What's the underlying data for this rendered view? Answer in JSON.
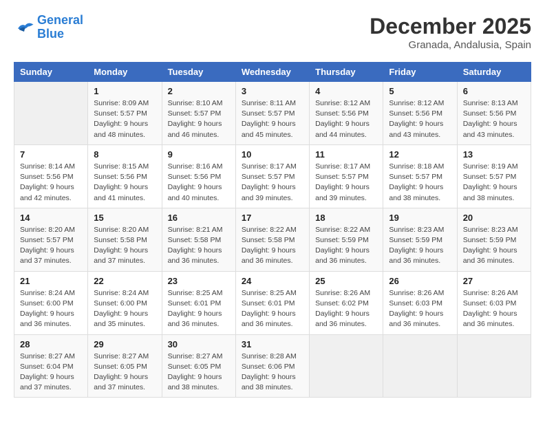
{
  "logo": {
    "line1": "General",
    "line2": "Blue"
  },
  "title": {
    "month": "December 2025",
    "location": "Granada, Andalusia, Spain"
  },
  "headers": [
    "Sunday",
    "Monday",
    "Tuesday",
    "Wednesday",
    "Thursday",
    "Friday",
    "Saturday"
  ],
  "weeks": [
    [
      {
        "day": "",
        "detail": ""
      },
      {
        "day": "1",
        "detail": "Sunrise: 8:09 AM\nSunset: 5:57 PM\nDaylight: 9 hours\nand 48 minutes."
      },
      {
        "day": "2",
        "detail": "Sunrise: 8:10 AM\nSunset: 5:57 PM\nDaylight: 9 hours\nand 46 minutes."
      },
      {
        "day": "3",
        "detail": "Sunrise: 8:11 AM\nSunset: 5:57 PM\nDaylight: 9 hours\nand 45 minutes."
      },
      {
        "day": "4",
        "detail": "Sunrise: 8:12 AM\nSunset: 5:56 PM\nDaylight: 9 hours\nand 44 minutes."
      },
      {
        "day": "5",
        "detail": "Sunrise: 8:12 AM\nSunset: 5:56 PM\nDaylight: 9 hours\nand 43 minutes."
      },
      {
        "day": "6",
        "detail": "Sunrise: 8:13 AM\nSunset: 5:56 PM\nDaylight: 9 hours\nand 43 minutes."
      }
    ],
    [
      {
        "day": "7",
        "detail": "Sunrise: 8:14 AM\nSunset: 5:56 PM\nDaylight: 9 hours\nand 42 minutes."
      },
      {
        "day": "8",
        "detail": "Sunrise: 8:15 AM\nSunset: 5:56 PM\nDaylight: 9 hours\nand 41 minutes."
      },
      {
        "day": "9",
        "detail": "Sunrise: 8:16 AM\nSunset: 5:56 PM\nDaylight: 9 hours\nand 40 minutes."
      },
      {
        "day": "10",
        "detail": "Sunrise: 8:17 AM\nSunset: 5:57 PM\nDaylight: 9 hours\nand 39 minutes."
      },
      {
        "day": "11",
        "detail": "Sunrise: 8:17 AM\nSunset: 5:57 PM\nDaylight: 9 hours\nand 39 minutes."
      },
      {
        "day": "12",
        "detail": "Sunrise: 8:18 AM\nSunset: 5:57 PM\nDaylight: 9 hours\nand 38 minutes."
      },
      {
        "day": "13",
        "detail": "Sunrise: 8:19 AM\nSunset: 5:57 PM\nDaylight: 9 hours\nand 38 minutes."
      }
    ],
    [
      {
        "day": "14",
        "detail": "Sunrise: 8:20 AM\nSunset: 5:57 PM\nDaylight: 9 hours\nand 37 minutes."
      },
      {
        "day": "15",
        "detail": "Sunrise: 8:20 AM\nSunset: 5:58 PM\nDaylight: 9 hours\nand 37 minutes."
      },
      {
        "day": "16",
        "detail": "Sunrise: 8:21 AM\nSunset: 5:58 PM\nDaylight: 9 hours\nand 36 minutes."
      },
      {
        "day": "17",
        "detail": "Sunrise: 8:22 AM\nSunset: 5:58 PM\nDaylight: 9 hours\nand 36 minutes."
      },
      {
        "day": "18",
        "detail": "Sunrise: 8:22 AM\nSunset: 5:59 PM\nDaylight: 9 hours\nand 36 minutes."
      },
      {
        "day": "19",
        "detail": "Sunrise: 8:23 AM\nSunset: 5:59 PM\nDaylight: 9 hours\nand 36 minutes."
      },
      {
        "day": "20",
        "detail": "Sunrise: 8:23 AM\nSunset: 5:59 PM\nDaylight: 9 hours\nand 36 minutes."
      }
    ],
    [
      {
        "day": "21",
        "detail": "Sunrise: 8:24 AM\nSunset: 6:00 PM\nDaylight: 9 hours\nand 36 minutes."
      },
      {
        "day": "22",
        "detail": "Sunrise: 8:24 AM\nSunset: 6:00 PM\nDaylight: 9 hours\nand 35 minutes."
      },
      {
        "day": "23",
        "detail": "Sunrise: 8:25 AM\nSunset: 6:01 PM\nDaylight: 9 hours\nand 36 minutes."
      },
      {
        "day": "24",
        "detail": "Sunrise: 8:25 AM\nSunset: 6:01 PM\nDaylight: 9 hours\nand 36 minutes."
      },
      {
        "day": "25",
        "detail": "Sunrise: 8:26 AM\nSunset: 6:02 PM\nDaylight: 9 hours\nand 36 minutes."
      },
      {
        "day": "26",
        "detail": "Sunrise: 8:26 AM\nSunset: 6:03 PM\nDaylight: 9 hours\nand 36 minutes."
      },
      {
        "day": "27",
        "detail": "Sunrise: 8:26 AM\nSunset: 6:03 PM\nDaylight: 9 hours\nand 36 minutes."
      }
    ],
    [
      {
        "day": "28",
        "detail": "Sunrise: 8:27 AM\nSunset: 6:04 PM\nDaylight: 9 hours\nand 37 minutes."
      },
      {
        "day": "29",
        "detail": "Sunrise: 8:27 AM\nSunset: 6:05 PM\nDaylight: 9 hours\nand 37 minutes."
      },
      {
        "day": "30",
        "detail": "Sunrise: 8:27 AM\nSunset: 6:05 PM\nDaylight: 9 hours\nand 38 minutes."
      },
      {
        "day": "31",
        "detail": "Sunrise: 8:28 AM\nSunset: 6:06 PM\nDaylight: 9 hours\nand 38 minutes."
      },
      {
        "day": "",
        "detail": ""
      },
      {
        "day": "",
        "detail": ""
      },
      {
        "day": "",
        "detail": ""
      }
    ]
  ]
}
